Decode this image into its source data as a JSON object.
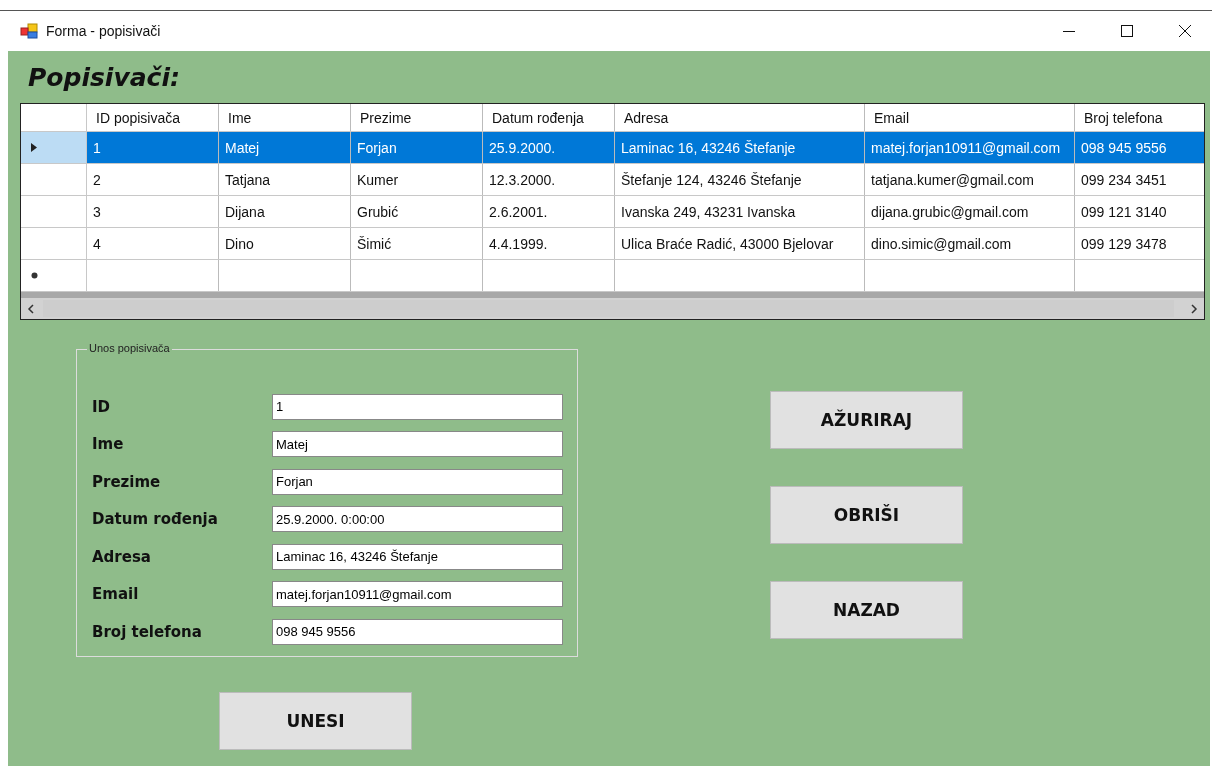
{
  "window": {
    "title": "Forma - popisivači"
  },
  "heading": "Popisivači:",
  "table": {
    "columns": [
      "ID popisivača",
      "Ime",
      "Prezime",
      "Datum rođenja",
      "Adresa",
      "Email",
      "Broj telefona"
    ],
    "rows": [
      {
        "selected": true,
        "cells": [
          "1",
          "Matej",
          "Forjan",
          "25.9.2000.",
          "Laminac 16, 43246 Štefanje",
          "matej.forjan10911@gmail.com",
          "098 945 9556"
        ]
      },
      {
        "selected": false,
        "cells": [
          "2",
          "Tatjana",
          "Kumer",
          "12.3.2000.",
          "Štefanje 124, 43246 Štefanje",
          "tatjana.kumer@gmail.com",
          "099 234 3451"
        ]
      },
      {
        "selected": false,
        "cells": [
          "3",
          "Dijana",
          "Grubić",
          "2.6.2001.",
          "Ivanska 249, 43231 Ivanska",
          "dijana.grubic@gmail.com",
          "099 121 3140"
        ]
      },
      {
        "selected": false,
        "cells": [
          "4",
          "Dino",
          "Šimić",
          "4.4.1999.",
          "Ulica Braće Radić, 43000 Bjelovar",
          "dino.simic@gmail.com",
          "099 129 3478"
        ]
      }
    ]
  },
  "group": {
    "title": "Unos popisivača",
    "fields": [
      {
        "label": "ID",
        "value": "1"
      },
      {
        "label": "Ime",
        "value": "Matej"
      },
      {
        "label": "Prezime",
        "value": "Forjan"
      },
      {
        "label": "Datum rođenja",
        "value": "25.9.2000. 0:00:00"
      },
      {
        "label": "Adresa",
        "value": "Laminac 16, 43246 Štefanje"
      },
      {
        "label": "Email",
        "value": "matej.forjan10911@gmail.com"
      },
      {
        "label": "Broj telefona",
        "value": "098 945 9556"
      }
    ]
  },
  "side_buttons": [
    "AŽURIRAJ",
    "OBRIŠI",
    "NAZAD"
  ],
  "submit_button": "UNESI"
}
